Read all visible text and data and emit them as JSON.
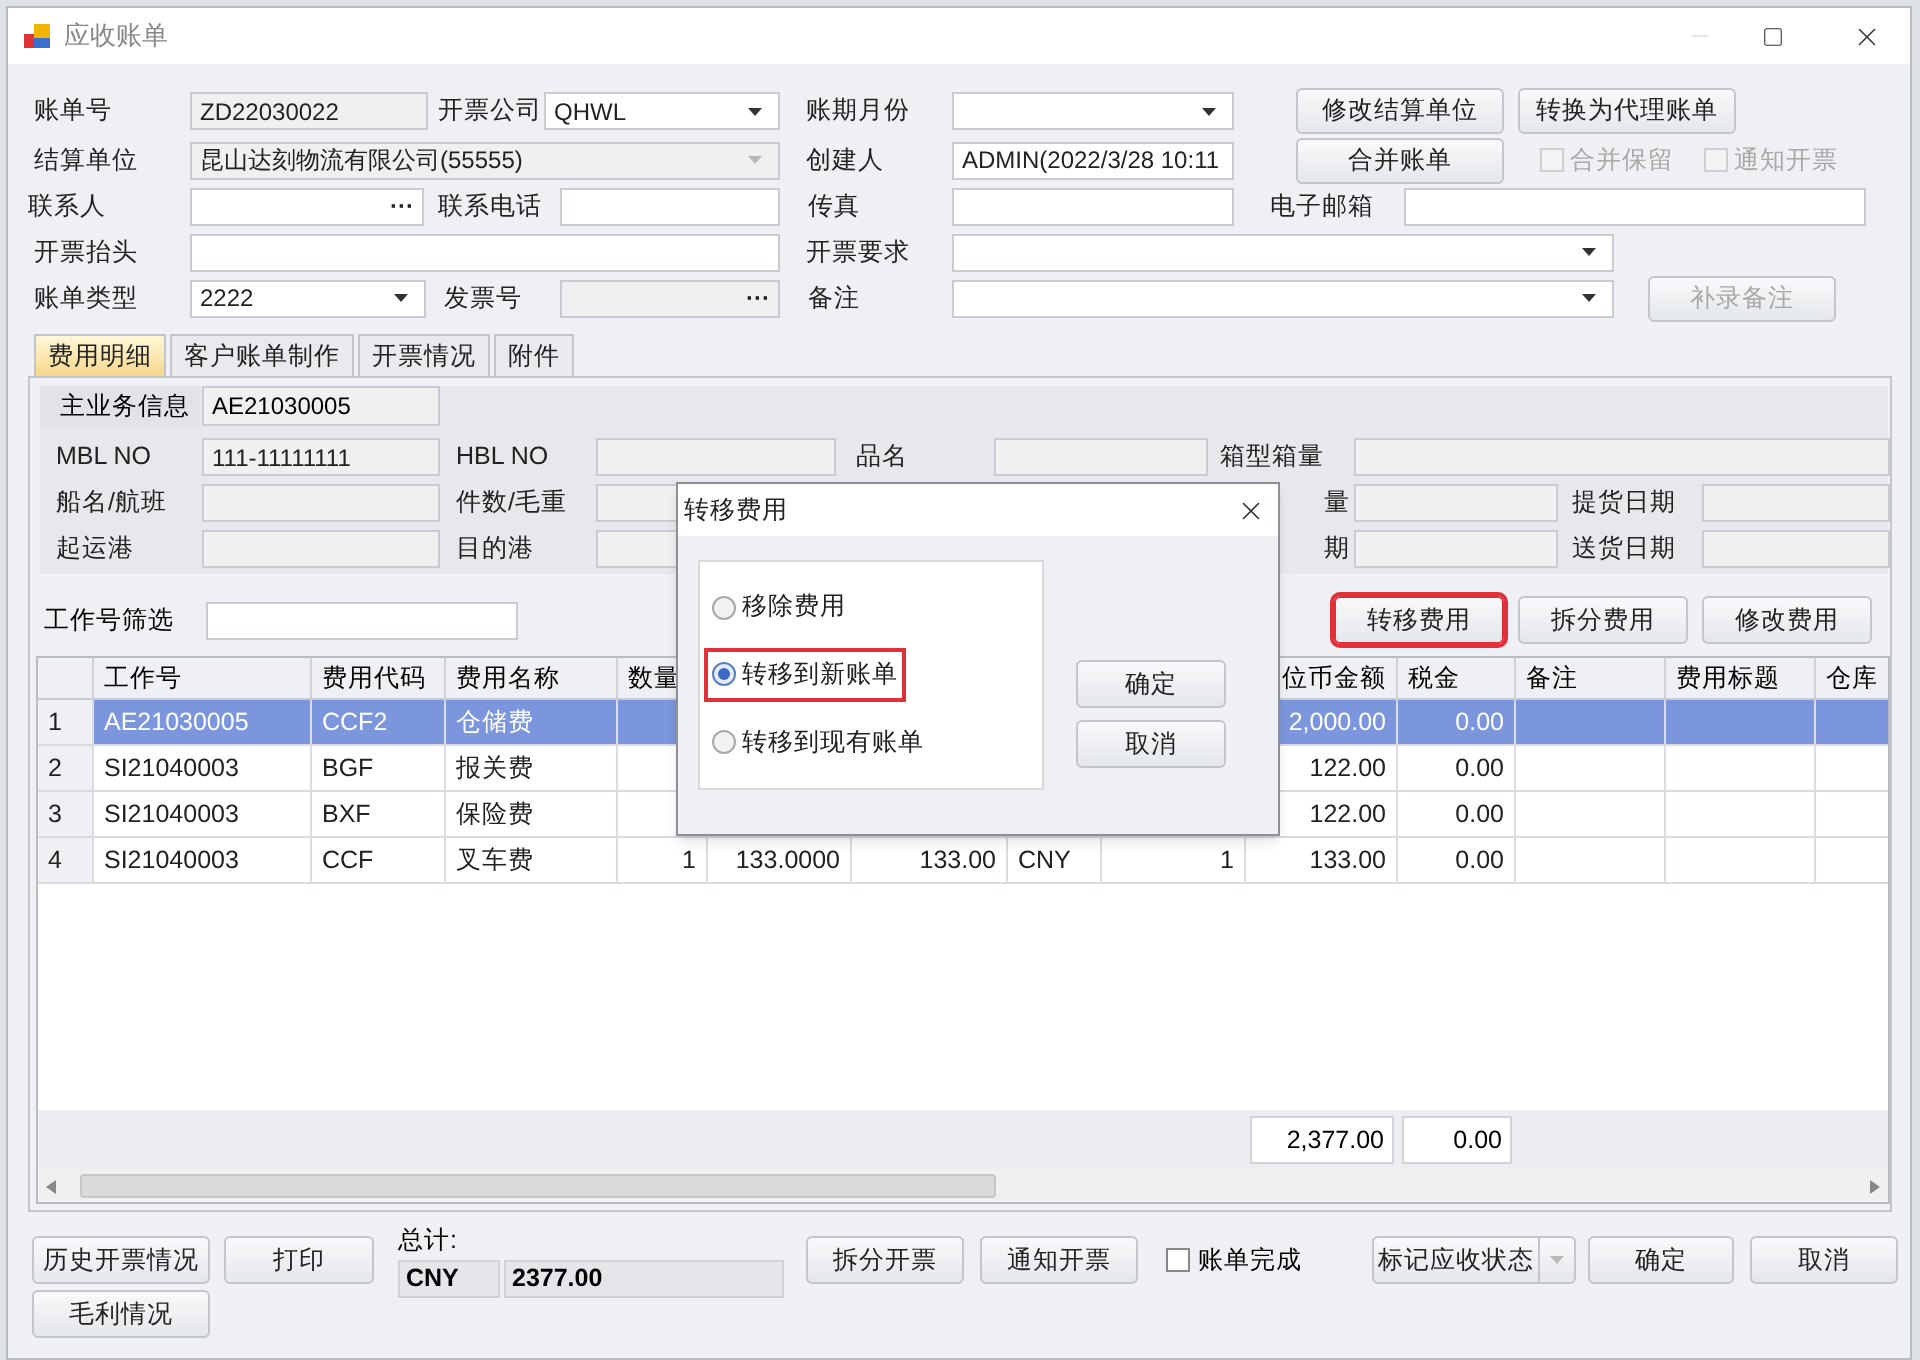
{
  "window": {
    "title": "应收账单"
  },
  "form_rows": [
    [
      {
        "kind": "label",
        "text": "账单号"
      },
      {
        "kind": "field",
        "value": "ZD22030022",
        "readonly": true
      },
      {
        "kind": "label",
        "text": "开票公司"
      },
      {
        "kind": "combo",
        "value": "QHWL",
        "disabled": false
      },
      {
        "kind": "label",
        "text": "账期月份"
      },
      {
        "kind": "combo",
        "disabled": false
      },
      {
        "kind": "button",
        "label": "修改结算单位",
        "disabled": false
      },
      {
        "kind": "button",
        "label": "转换为代理账单",
        "disabled": false
      }
    ],
    [
      {
        "kind": "label",
        "text": "结算单位"
      },
      {
        "kind": "combo",
        "value": "昆山达刻物流有限公司(55555)",
        "disabled": true
      },
      {
        "kind": "label",
        "text": "创建人"
      },
      {
        "kind": "field",
        "value": "ADMIN(2022/3/28 10:11",
        "readonly": false
      },
      {
        "kind": "button",
        "label": "合并账单",
        "disabled": false
      },
      {
        "kind": "checkbox",
        "label": "合并保留",
        "checked": false,
        "disabled": true
      },
      {
        "kind": "checkbox",
        "label": "通知开票",
        "checked": false,
        "disabled": true
      }
    ],
    [
      {
        "kind": "label",
        "text": "联系人"
      },
      {
        "kind": "lookup",
        "button_text": "···",
        "readonly": false
      },
      {
        "kind": "label",
        "text": "联系电话"
      },
      {
        "kind": "field",
        "readonly": false
      },
      {
        "kind": "label",
        "text": "传真"
      },
      {
        "kind": "field",
        "readonly": false
      },
      {
        "kind": "label",
        "text": "电子邮箱"
      },
      {
        "kind": "field",
        "readonly": false
      }
    ],
    [
      {
        "kind": "label",
        "text": "开票抬头"
      },
      {
        "kind": "field",
        "readonly": false
      },
      {
        "kind": "label",
        "text": "开票要求"
      },
      {
        "kind": "combo",
        "disabled": false
      }
    ],
    [
      {
        "kind": "label",
        "text": "账单类型"
      },
      {
        "kind": "combo",
        "value": "2222",
        "disabled": false
      },
      {
        "kind": "label",
        "text": "发票号"
      },
      {
        "kind": "lookup",
        "button_text": "···",
        "readonly": true
      },
      {
        "kind": "label",
        "text": "备注"
      },
      {
        "kind": "combo",
        "disabled": false
      },
      {
        "kind": "button",
        "label": "补录备注",
        "disabled": true
      }
    ]
  ],
  "tabs": [
    {
      "label": "费用明细",
      "selected": true
    },
    {
      "label": "客户账单制作",
      "selected": false
    },
    {
      "label": "开票情况",
      "selected": false
    },
    {
      "label": "附件",
      "selected": false
    }
  ],
  "main_info": {
    "label": "主业务信息",
    "value": "AE21030005"
  },
  "info_rows": [
    [
      {
        "kind": "label",
        "text": "MBL NO"
      },
      {
        "kind": "field",
        "value": "111-11111111",
        "readonly": true
      },
      {
        "kind": "label",
        "text": "HBL NO"
      },
      {
        "kind": "field",
        "readonly": true
      },
      {
        "kind": "label",
        "text": "品名"
      },
      {
        "kind": "field",
        "readonly": true
      },
      {
        "kind": "label",
        "text": "箱型箱量"
      },
      {
        "kind": "field",
        "readonly": true
      }
    ],
    [
      {
        "kind": "label",
        "text": "船名/航班"
      },
      {
        "kind": "field",
        "readonly": true
      },
      {
        "kind": "label",
        "text": "件数/毛重"
      },
      {
        "kind": "field",
        "readonly": true
      },
      {
        "kind": "label",
        "text": "量"
      },
      {
        "kind": "field",
        "readonly": true
      },
      {
        "kind": "label",
        "text": "提货日期"
      },
      {
        "kind": "field",
        "readonly": true
      }
    ],
    [
      {
        "kind": "label",
        "text": "起运港"
      },
      {
        "kind": "field",
        "readonly": true
      },
      {
        "kind": "label",
        "text": "目的港"
      },
      {
        "kind": "field",
        "readonly": true
      },
      {
        "kind": "label",
        "text": "期"
      },
      {
        "kind": "field",
        "readonly": true
      },
      {
        "kind": "label",
        "text": "送货日期"
      },
      {
        "kind": "field",
        "readonly": true
      }
    ]
  ],
  "filter": {
    "label": "工作号筛选"
  },
  "actions": [
    {
      "label": "转移费用",
      "highlighted": true
    },
    {
      "label": "拆分费用",
      "highlighted": false
    },
    {
      "label": "修改费用",
      "highlighted": false
    }
  ],
  "grid": {
    "columns": [
      null,
      "工作号",
      "费用代码",
      "费用名称",
      "数量",
      null,
      null,
      null,
      null,
      "位币金额",
      "税金",
      "备注",
      "费用标题",
      "仓库"
    ],
    "rows": [
      {
        "selected": true,
        "left_cells": [
          "1",
          "AE21030005",
          "CCF2",
          "仓储费"
        ],
        "amount_cells": [
          "2,000.00",
          "0.00"
        ]
      },
      {
        "selected": false,
        "left_cells": [
          "2",
          "SI21040003",
          "BGF",
          "报关费"
        ],
        "amount_cells": [
          "122.00",
          "0.00"
        ]
      },
      {
        "selected": false,
        "left_cells": [
          "3",
          "SI21040003",
          "BXF",
          "保险费"
        ],
        "amount_cells": [
          "122.00",
          "0.00"
        ]
      },
      {
        "selected": false,
        "left_cells": [
          "4",
          "SI21040003",
          "CCF",
          "叉车费",
          "1",
          "133.0000",
          "133.00",
          "CNY",
          "1"
        ],
        "amount_cells": [
          "133.00",
          "0.00"
        ]
      }
    ],
    "totals": [
      "2,377.00",
      "0.00"
    ]
  },
  "bottom": {
    "left_buttons": [
      "历史开票情况",
      "毛利情况"
    ],
    "print": "打印",
    "total_label": "总计:",
    "currency": "CNY",
    "total": "2377.00",
    "buttons": [
      "拆分开票",
      "通知开票"
    ],
    "done": {
      "label": "账单完成",
      "checked": false
    },
    "status_button": "标记应收状态",
    "ok": "确定",
    "cancel": "取消"
  },
  "dialog": {
    "title": "转移费用",
    "options": [
      {
        "label": "移除费用",
        "selected": false,
        "highlighted": false
      },
      {
        "label": "转移到新账单",
        "selected": true,
        "highlighted": true
      },
      {
        "label": "转移到现有账单",
        "selected": false,
        "highlighted": false
      }
    ],
    "buttons": [
      "确定",
      "取消"
    ]
  }
}
